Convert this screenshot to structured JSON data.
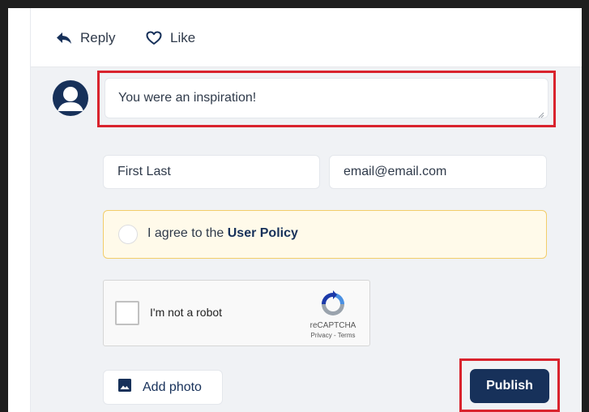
{
  "actions": {
    "reply_label": "Reply",
    "reply_icon": "reply-arrow-icon",
    "like_label": "Like",
    "like_icon": "heart-outline-icon"
  },
  "comment": {
    "avatar_icon": "user-avatar-icon",
    "value": "You were an inspiration!",
    "highlight_color": "#d9232d"
  },
  "author": {
    "name_placeholder": "First Last",
    "email_placeholder": "email@email.com"
  },
  "policy": {
    "agree_text": "I agree to the ",
    "link_text": "User Policy",
    "checked": false
  },
  "captcha": {
    "label": "I'm not a robot",
    "brand": "reCAPTCHA",
    "privacy_link": "Privacy",
    "separator": " - ",
    "terms_link": "Terms",
    "logo_icon": "recaptcha-logo-icon"
  },
  "buttons": {
    "add_photo_label": "Add photo",
    "add_photo_icon": "image-icon",
    "publish_label": "Publish"
  },
  "colors": {
    "primary": "#17315a",
    "policy_background": "#fffaea",
    "policy_border": "#f2cd6a",
    "highlight": "#d9232d"
  }
}
